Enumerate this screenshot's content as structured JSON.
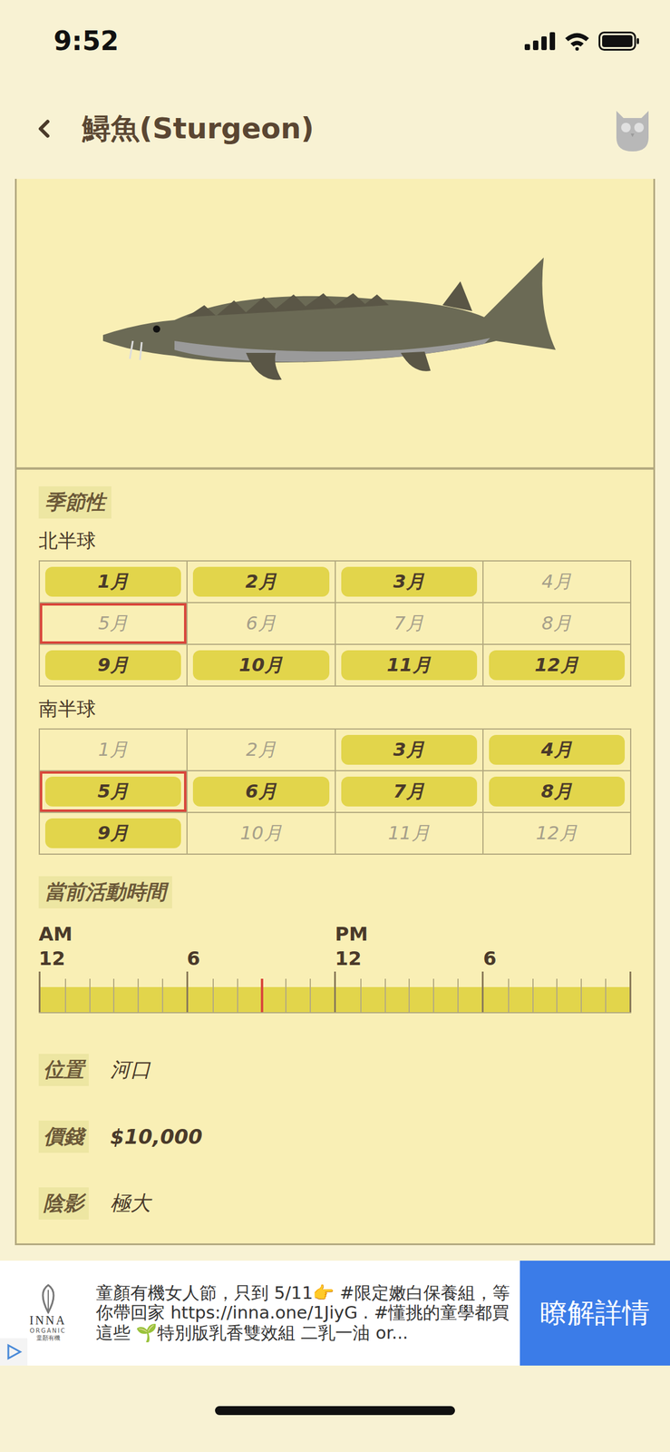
{
  "status_bar": {
    "time": "9:52"
  },
  "header": {
    "title": "鱘魚(Sturgeon)"
  },
  "seasonality": {
    "label": "季節性",
    "hemispheres": [
      {
        "name": "北半球",
        "months": [
          {
            "label": "1月",
            "active": true,
            "current": false
          },
          {
            "label": "2月",
            "active": true,
            "current": false
          },
          {
            "label": "3月",
            "active": true,
            "current": false
          },
          {
            "label": "4月",
            "active": false,
            "current": false
          },
          {
            "label": "5月",
            "active": false,
            "current": true
          },
          {
            "label": "6月",
            "active": false,
            "current": false
          },
          {
            "label": "7月",
            "active": false,
            "current": false
          },
          {
            "label": "8月",
            "active": false,
            "current": false
          },
          {
            "label": "9月",
            "active": true,
            "current": false
          },
          {
            "label": "10月",
            "active": true,
            "current": false
          },
          {
            "label": "11月",
            "active": true,
            "current": false
          },
          {
            "label": "12月",
            "active": true,
            "current": false
          }
        ]
      },
      {
        "name": "南半球",
        "months": [
          {
            "label": "1月",
            "active": false,
            "current": false
          },
          {
            "label": "2月",
            "active": false,
            "current": false
          },
          {
            "label": "3月",
            "active": true,
            "current": false
          },
          {
            "label": "4月",
            "active": true,
            "current": false
          },
          {
            "label": "5月",
            "active": true,
            "current": true
          },
          {
            "label": "6月",
            "active": true,
            "current": false
          },
          {
            "label": "7月",
            "active": true,
            "current": false
          },
          {
            "label": "8月",
            "active": true,
            "current": false
          },
          {
            "label": "9月",
            "active": true,
            "current": false
          },
          {
            "label": "10月",
            "active": false,
            "current": false
          },
          {
            "label": "11月",
            "active": false,
            "current": false
          },
          {
            "label": "12月",
            "active": false,
            "current": false
          }
        ]
      }
    ]
  },
  "activity": {
    "label": "當前活動時間",
    "am": "AM",
    "pm": "PM",
    "ticks": [
      "12",
      "6",
      "12",
      "6"
    ],
    "hours": [
      true,
      true,
      true,
      true,
      true,
      true,
      true,
      true,
      true,
      true,
      true,
      true,
      true,
      true,
      true,
      true,
      true,
      true,
      true,
      true,
      true,
      true,
      true,
      true
    ],
    "current_level": 0.377
  },
  "details": [
    {
      "label": "位置",
      "value": "河口"
    },
    {
      "label": "價錢",
      "value": "$10,000"
    },
    {
      "label": "陰影",
      "value": "極大"
    }
  ],
  "ad": {
    "brand": "INNA",
    "brand_sub": "ORGANIC",
    "brand_cn": "童顏有機",
    "text": "童顏有機女人節，只到 5/11👉 #限定嫩白保養組，等你帶回家 https://inna.one/1JiyG . #懂挑的童學都買這些 🌱特別版乳香雙效組 二乳一油 or...",
    "button": "瞭解詳情"
  }
}
